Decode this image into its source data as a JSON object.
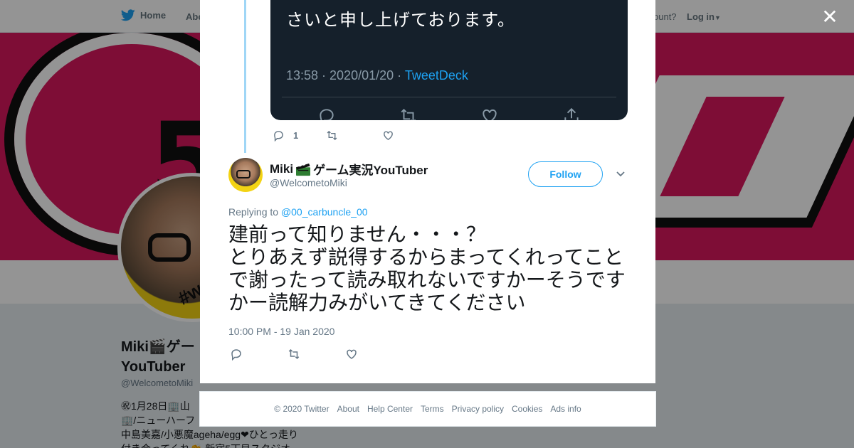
{
  "nav": {
    "home": "Home",
    "about": "Abo",
    "account_prompt": "ccount?",
    "login": "Log in"
  },
  "profile": {
    "name": "Miki🎬ゲー",
    "name_line2": "YouTuber",
    "handle": "@WelcometoMiki",
    "bio_line1": "㊗1月28日🏢山",
    "bio_line2": "🏢/ニューハーフ",
    "bio_line3": "中島美嘉/小悪魔ageha/egg❤ひとっ走り",
    "bio_line4": "付き合ってくれ👏 新宿5丁目スタジオ"
  },
  "quoted": {
    "text": "さいと申し上げております。",
    "time": "13:58 · 2020/01/20 · ",
    "source": "TweetDeck"
  },
  "prev_tweet": {
    "reply_count": "1"
  },
  "tweet": {
    "name": "Miki",
    "name_suffix": "ゲーム実況YouTuber",
    "handle": "@WelcometoMiki",
    "follow_label": "Follow",
    "replying_prefix": "Replying to ",
    "replying_to": "@00_carbuncle_00",
    "body": "建前って知りません・・・？\nとりあえず説得するからまってくれってことで謝ったって読み取れないですかーそうですかー読解力みがいてきてください",
    "time": "10:00 PM - 19 Jan 2020"
  },
  "footer": {
    "copyright": "© 2020 Twitter",
    "links": [
      "About",
      "Help Center",
      "Terms",
      "Privacy policy",
      "Cookies",
      "Ads info"
    ]
  },
  "colors": {
    "twitter_blue": "#1da1f2",
    "banner_pink": "#d9185e",
    "dark_card": "#15202b"
  }
}
